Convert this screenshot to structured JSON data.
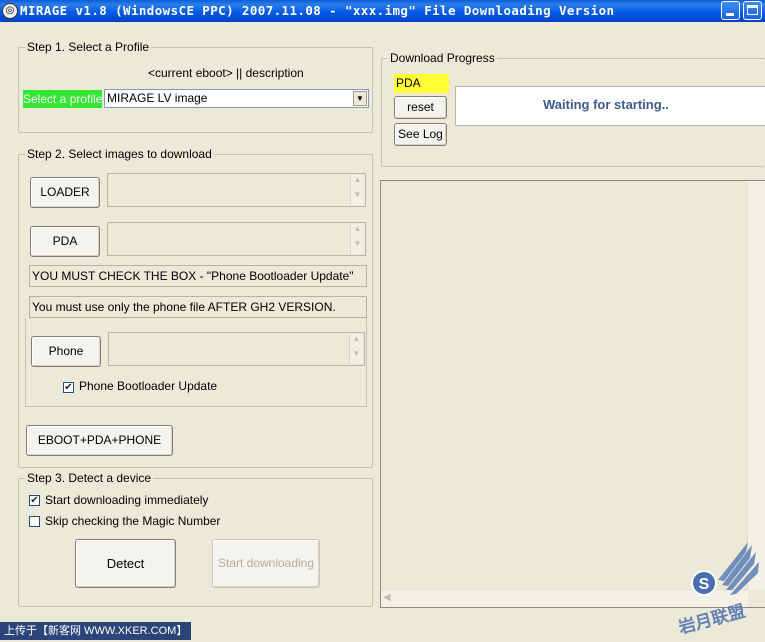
{
  "window": {
    "title": "MIRAGE v1.8 (WindowsCE PPC) 2007.11.08  - \"xxx.img\" File Downloading Version"
  },
  "step1": {
    "legend": "Step 1. Select a Profile",
    "column_header": "<current eboot> || description",
    "select_label": "Select a profile",
    "select_value": "MIRAGE LV image",
    "highlight_color": "#33e633"
  },
  "step2": {
    "legend": "Step 2. Select images to download",
    "loader_button": "LOADER",
    "pda_button": "PDA",
    "notice_check_box": "YOU MUST CHECK THE BOX  -  \"Phone Bootloader Update\"",
    "notice_phone_file": "You must use only the phone file AFTER  GH2 VERSION.",
    "phone_button": "Phone",
    "bootloader_checkbox_label": "Phone Bootloader Update",
    "bootloader_checked": true,
    "combined_button": "EBOOT+PDA+PHONE"
  },
  "step3": {
    "legend": "Step 3. Detect a device",
    "start_immediately_label": "Start downloading immediately",
    "start_immediately_checked": true,
    "skip_magic_label": "Skip checking the Magic Number",
    "skip_magic_checked": false,
    "detect_button": "Detect",
    "start_download_button": "Start downloading"
  },
  "download_progress": {
    "legend": "Download Progress",
    "pda_label": "PDA",
    "pda_label_color": "#ffff33",
    "reset_button": "reset",
    "see_log_button": "See Log",
    "status": "Waiting for starting.."
  },
  "footer": {
    "caption": "上传于【新客网 WWW.XKER.COM】"
  },
  "watermark": {
    "text": "岩月联盟"
  }
}
